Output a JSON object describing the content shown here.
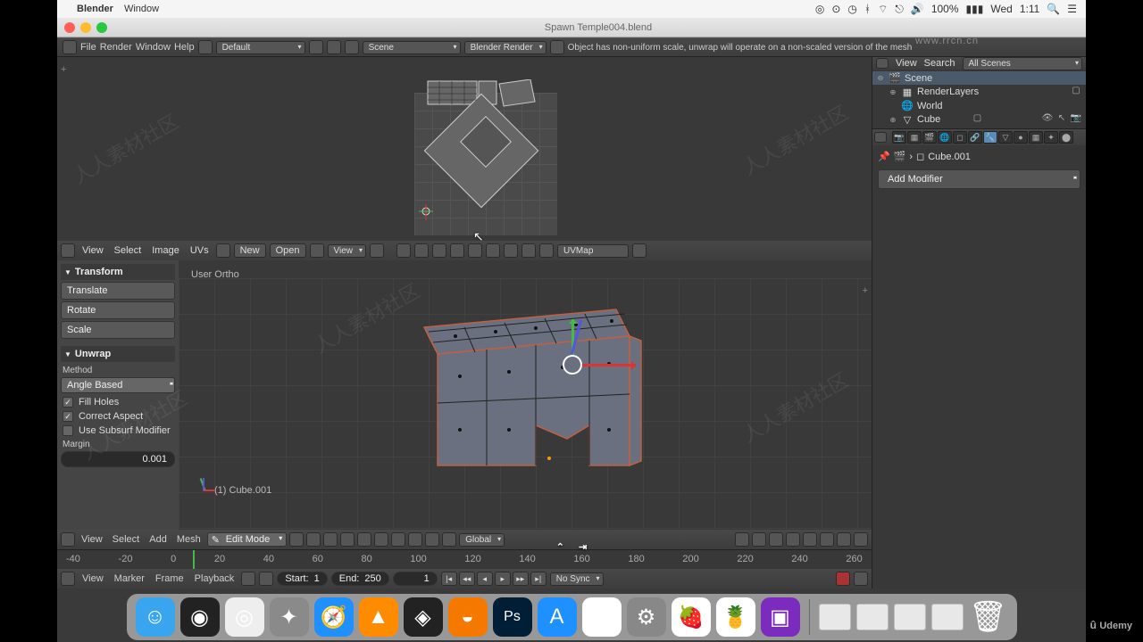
{
  "mac_menu": {
    "app": "Blender",
    "items": [
      "Window"
    ],
    "battery": "100%",
    "charge_icon": "⚡",
    "day": "Wed",
    "time": "1:11"
  },
  "titlebar": {
    "filename": "Spawn Temple004.blend"
  },
  "info_header": {
    "menus": [
      "File",
      "Render",
      "Window",
      "Help"
    ],
    "layout": "Default",
    "scene": "Scene",
    "engine": "Blender Render",
    "message": "Object has non-uniform scale, unwrap will operate on a non-scaled version of the mesh"
  },
  "uv_editor": {
    "menus": [
      "View",
      "Select",
      "Image",
      "UVs"
    ],
    "new": "New",
    "open": "Open",
    "view_btn": "View",
    "uvmap": "UVMap"
  },
  "tool_panel": {
    "transform_hdr": "Transform",
    "translate": "Translate",
    "rotate": "Rotate",
    "scale": "Scale",
    "unwrap_hdr": "Unwrap",
    "method_lbl": "Method",
    "method_val": "Angle Based",
    "fill_holes": "Fill Holes",
    "correct_aspect": "Correct Aspect",
    "use_subsurf": "Use Subsurf Modifier",
    "margin_lbl": "Margin",
    "margin_val": "0.001"
  },
  "viewport": {
    "ortho": "User Ortho",
    "object_label": "(1) Cube.001",
    "menus": [
      "View",
      "Select",
      "Add",
      "Mesh"
    ],
    "mode": "Edit Mode",
    "orientation": "Global"
  },
  "timeline": {
    "ticks": [
      "-40",
      "-20",
      "0",
      "20",
      "40",
      "60",
      "80",
      "100",
      "120",
      "140",
      "160",
      "180",
      "200",
      "220",
      "240",
      "260"
    ],
    "menus": [
      "View",
      "Marker",
      "Frame",
      "Playback"
    ],
    "start_lbl": "Start:",
    "start_val": "1",
    "end_lbl": "End:",
    "end_val": "250",
    "frame_val": "1",
    "sync": "No Sync"
  },
  "outliner": {
    "bar": {
      "view": "View",
      "search": "Search",
      "filter": "All Scenes"
    },
    "scene": "Scene",
    "renderlayers": "RenderLayers",
    "world": "World",
    "cube": "Cube"
  },
  "properties": {
    "breadcrumb_obj": "Cube.001",
    "add_modifier": "Add Modifier"
  },
  "dock_apps": [
    {
      "name": "finder",
      "bg": "#3aa5ef",
      "glyph": "☺"
    },
    {
      "name": "siri",
      "bg": "#222",
      "glyph": "◉"
    },
    {
      "name": "chrome",
      "bg": "#eee",
      "glyph": "◎"
    },
    {
      "name": "launchpad",
      "bg": "#8a8a8a",
      "glyph": "✦"
    },
    {
      "name": "safari",
      "bg": "#1e90ff",
      "glyph": "🧭"
    },
    {
      "name": "vlc",
      "bg": "#ff8c00",
      "glyph": "▲"
    },
    {
      "name": "unity",
      "bg": "#222",
      "glyph": "◈"
    },
    {
      "name": "blender",
      "bg": "#f57900",
      "glyph": "◒"
    },
    {
      "name": "photoshop",
      "bg": "#001e36",
      "glyph": "Ps"
    },
    {
      "name": "appstore",
      "bg": "#1e90ff",
      "glyph": "A"
    },
    {
      "name": "photos",
      "bg": "#fff",
      "glyph": "✿"
    },
    {
      "name": "settings",
      "bg": "#888",
      "glyph": "⚙"
    },
    {
      "name": "fruit1",
      "bg": "#fff",
      "glyph": "🍓"
    },
    {
      "name": "fruit2",
      "bg": "#fff",
      "glyph": "🍍"
    },
    {
      "name": "media",
      "bg": "#7b2cbf",
      "glyph": "▣"
    }
  ],
  "watermark_top": "www.rrcn.cn",
  "watermark_text": "人人素材社区",
  "udemy": "Udemy"
}
